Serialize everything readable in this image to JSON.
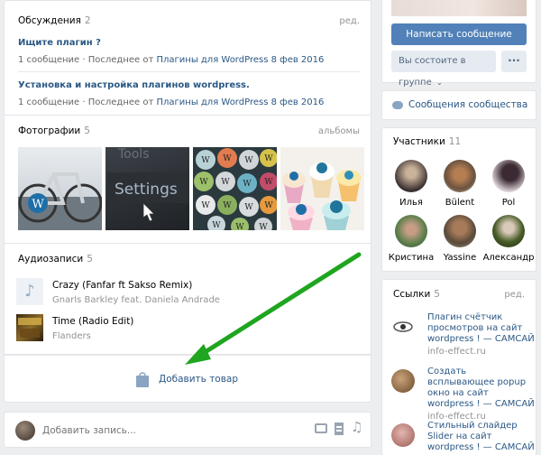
{
  "discussions": {
    "title": "Обсуждения",
    "count": "2",
    "edit": "ред.",
    "topics": [
      {
        "title": "Ищите плагин ?",
        "meta_prefix": "1 сообщение · Последнее от ",
        "author": "Плагины для WordPress",
        "date": "8 фев 2016"
      },
      {
        "title": "Установка и настройка плагинов wordpress.",
        "meta_prefix": "1 сообщение · Последнее от ",
        "author": "Плагины для WordPress",
        "date": "8 фев 2016"
      }
    ]
  },
  "photos": {
    "title": "Фотографии",
    "count": "5",
    "albums": "альбомы",
    "settings_text": "Settings",
    "tools_text": "Tools"
  },
  "audio": {
    "title": "Аудиозаписи",
    "count": "5",
    "tracks": [
      {
        "title": "Crazy (Fanfar ft Sakso Remix)",
        "artist": "Gnarls Barkley feat. Daniela Andrade"
      },
      {
        "title": "Time (Radio Edit)",
        "artist": "Flanders"
      }
    ]
  },
  "add_product": "Добавить товар",
  "post_box": {
    "placeholder": "Добавить запись..."
  },
  "sidebar": {
    "write_message": "Написать сообщение",
    "in_group": "Вы состоите в группе",
    "more": "···",
    "community_messages": "Сообщения сообщества",
    "members_title": "Участники",
    "members_count": "11",
    "members": [
      {
        "name": "Илья"
      },
      {
        "name": "Bülent"
      },
      {
        "name": "Pol"
      },
      {
        "name": "Кристина"
      },
      {
        "name": "Yassine"
      },
      {
        "name": "Александр"
      }
    ],
    "links_title": "Ссылки",
    "links_count": "5",
    "links_edit": "ред.",
    "links": [
      {
        "text": "Плагин счётчик просмотров на сайт wordpress ! — САМСАЙ",
        "url": "info-effect.ru"
      },
      {
        "text": "Создать всплывающее popup окно на сайт wordpress ! — САМСАЙ",
        "url": "info-effect.ru"
      },
      {
        "text": "Стильный слайдер Slider на сайт wordpress ! — САМСАЙ",
        "url": ""
      }
    ]
  },
  "colors": {
    "accent": "#5181b8",
    "link": "#2a5885",
    "arrow": "#1fa51f",
    "background": "#edeef0"
  }
}
